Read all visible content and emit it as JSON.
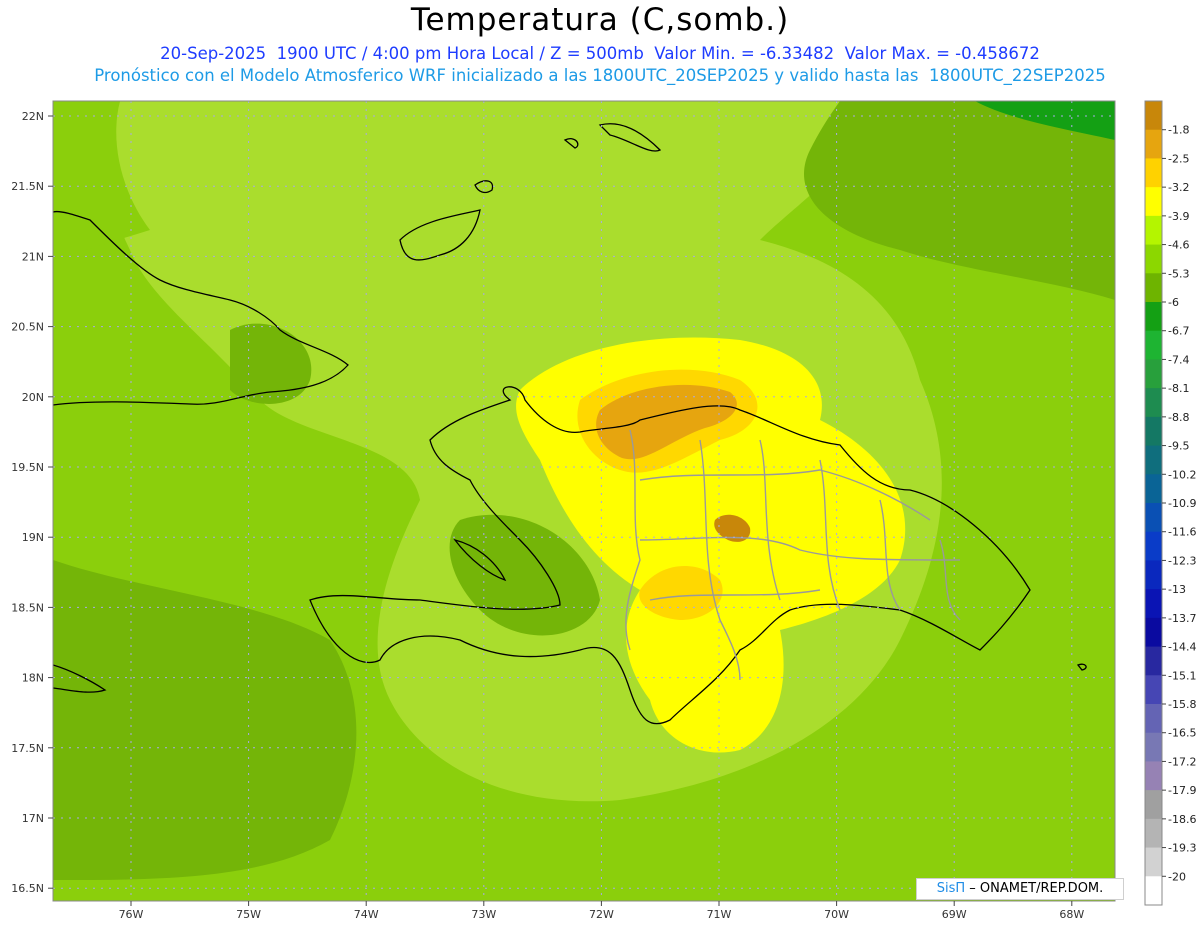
{
  "header": {
    "title": "Temperatura (C,somb.)",
    "line1": "20-Sep-2025  1900 UTC / 4:00 pm Hora Local / Z = 500mb  Valor Min. = -6.33482  Valor Max. = -0.458672",
    "line2": "Pronóstico con el Modelo Atmosferico WRF inicializado a las 1800UTC_20SEP2025 y valido hasta las  1800UTC_22SEP2025"
  },
  "axes": {
    "lat_labels": [
      "22N",
      "21.5N",
      "21N",
      "20.5N",
      "20N",
      "19.5N",
      "19N",
      "18.5N",
      "18N",
      "17.5N",
      "17N",
      "16.5N"
    ],
    "lon_labels": [
      "76W",
      "75W",
      "74W",
      "73W",
      "72W",
      "71W",
      "70W",
      "69W",
      "68W"
    ]
  },
  "legend": {
    "labels": [
      "-1.8",
      "-2.5",
      "-3.2",
      "-3.9",
      "-4.6",
      "-5.3",
      "-6",
      "-6.7",
      "-7.4",
      "-8.1",
      "-8.8",
      "-9.5",
      "-10.2",
      "-10.9",
      "-11.6",
      "-12.3",
      "-13",
      "-13.7",
      "-14.4",
      "-15.1",
      "-15.8",
      "-16.5",
      "-17.2",
      "-17.9",
      "-18.6",
      "-19.3",
      "-20"
    ],
    "colors": [
      "#c8870a",
      "#e6a50f",
      "#ffd200",
      "#ffff00",
      "#b4f500",
      "#8cd700",
      "#6eb400",
      "#14a014",
      "#1eb432",
      "#28a03c",
      "#1e8c50",
      "#147864",
      "#0f6e7d",
      "#0a6496",
      "#0a50b4",
      "#0a3cc8",
      "#0a28be",
      "#0a14b4",
      "#0a0aa0",
      "#2828a0",
      "#4646b4",
      "#6464b4",
      "#7878b4",
      "#9682b4",
      "#a0a0a0",
      "#b4b4b4",
      "#d2d2d2",
      "#ffffff"
    ]
  },
  "field_colors": {
    "dark_green": "#74b508",
    "green": "#8bcf0c",
    "light_green": "#aadd2d",
    "yellow": "#ffff00",
    "gold": "#ffd800",
    "orange": "#e6a50f",
    "rust": "#c8870a"
  },
  "credit": {
    "brand": "SisΠ",
    "org": " – ONAMET/REP.DOM."
  }
}
